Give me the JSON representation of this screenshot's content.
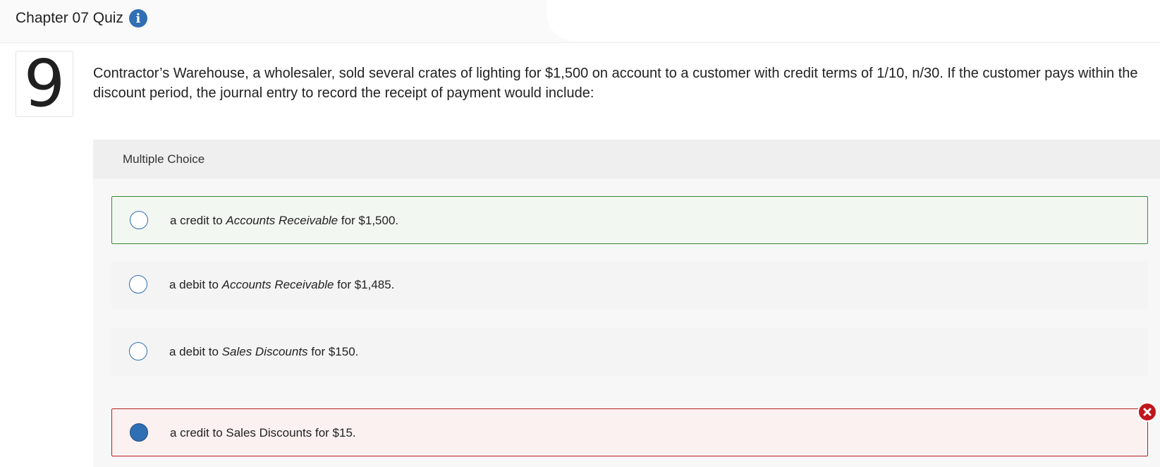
{
  "header": {
    "title": "Chapter 07 Quiz",
    "info_icon": "info-icon"
  },
  "question": {
    "number": "9",
    "text": "Contractor’s Warehouse, a wholesaler, sold several crates of lighting for $1,500 on account to a customer with credit terms of 1/10, n/30. If the customer pays within the discount period, the journal entry to record the receipt of payment would include:"
  },
  "multiple_choice": {
    "label": "Multiple Choice",
    "options": [
      {
        "prefix": "a credit to ",
        "account": "Accounts Receivable",
        "suffix": " for $1,500.",
        "selected": false,
        "state": "correct-outline"
      },
      {
        "prefix": "a debit to ",
        "account": "Accounts Receivable",
        "suffix": " for $1,485.",
        "selected": false,
        "state": "neutral"
      },
      {
        "prefix": "a debit to ",
        "account": "Sales Discounts",
        "suffix": " for $150.",
        "selected": false,
        "state": "neutral"
      },
      {
        "text": "a credit to Sales Discounts for $15.",
        "selected": true,
        "state": "wrong",
        "status_icon": "x-circle-icon"
      }
    ]
  },
  "colors": {
    "accent": "#2f6fb3",
    "correct": "#3b8a3b",
    "wrong": "#b32020"
  }
}
